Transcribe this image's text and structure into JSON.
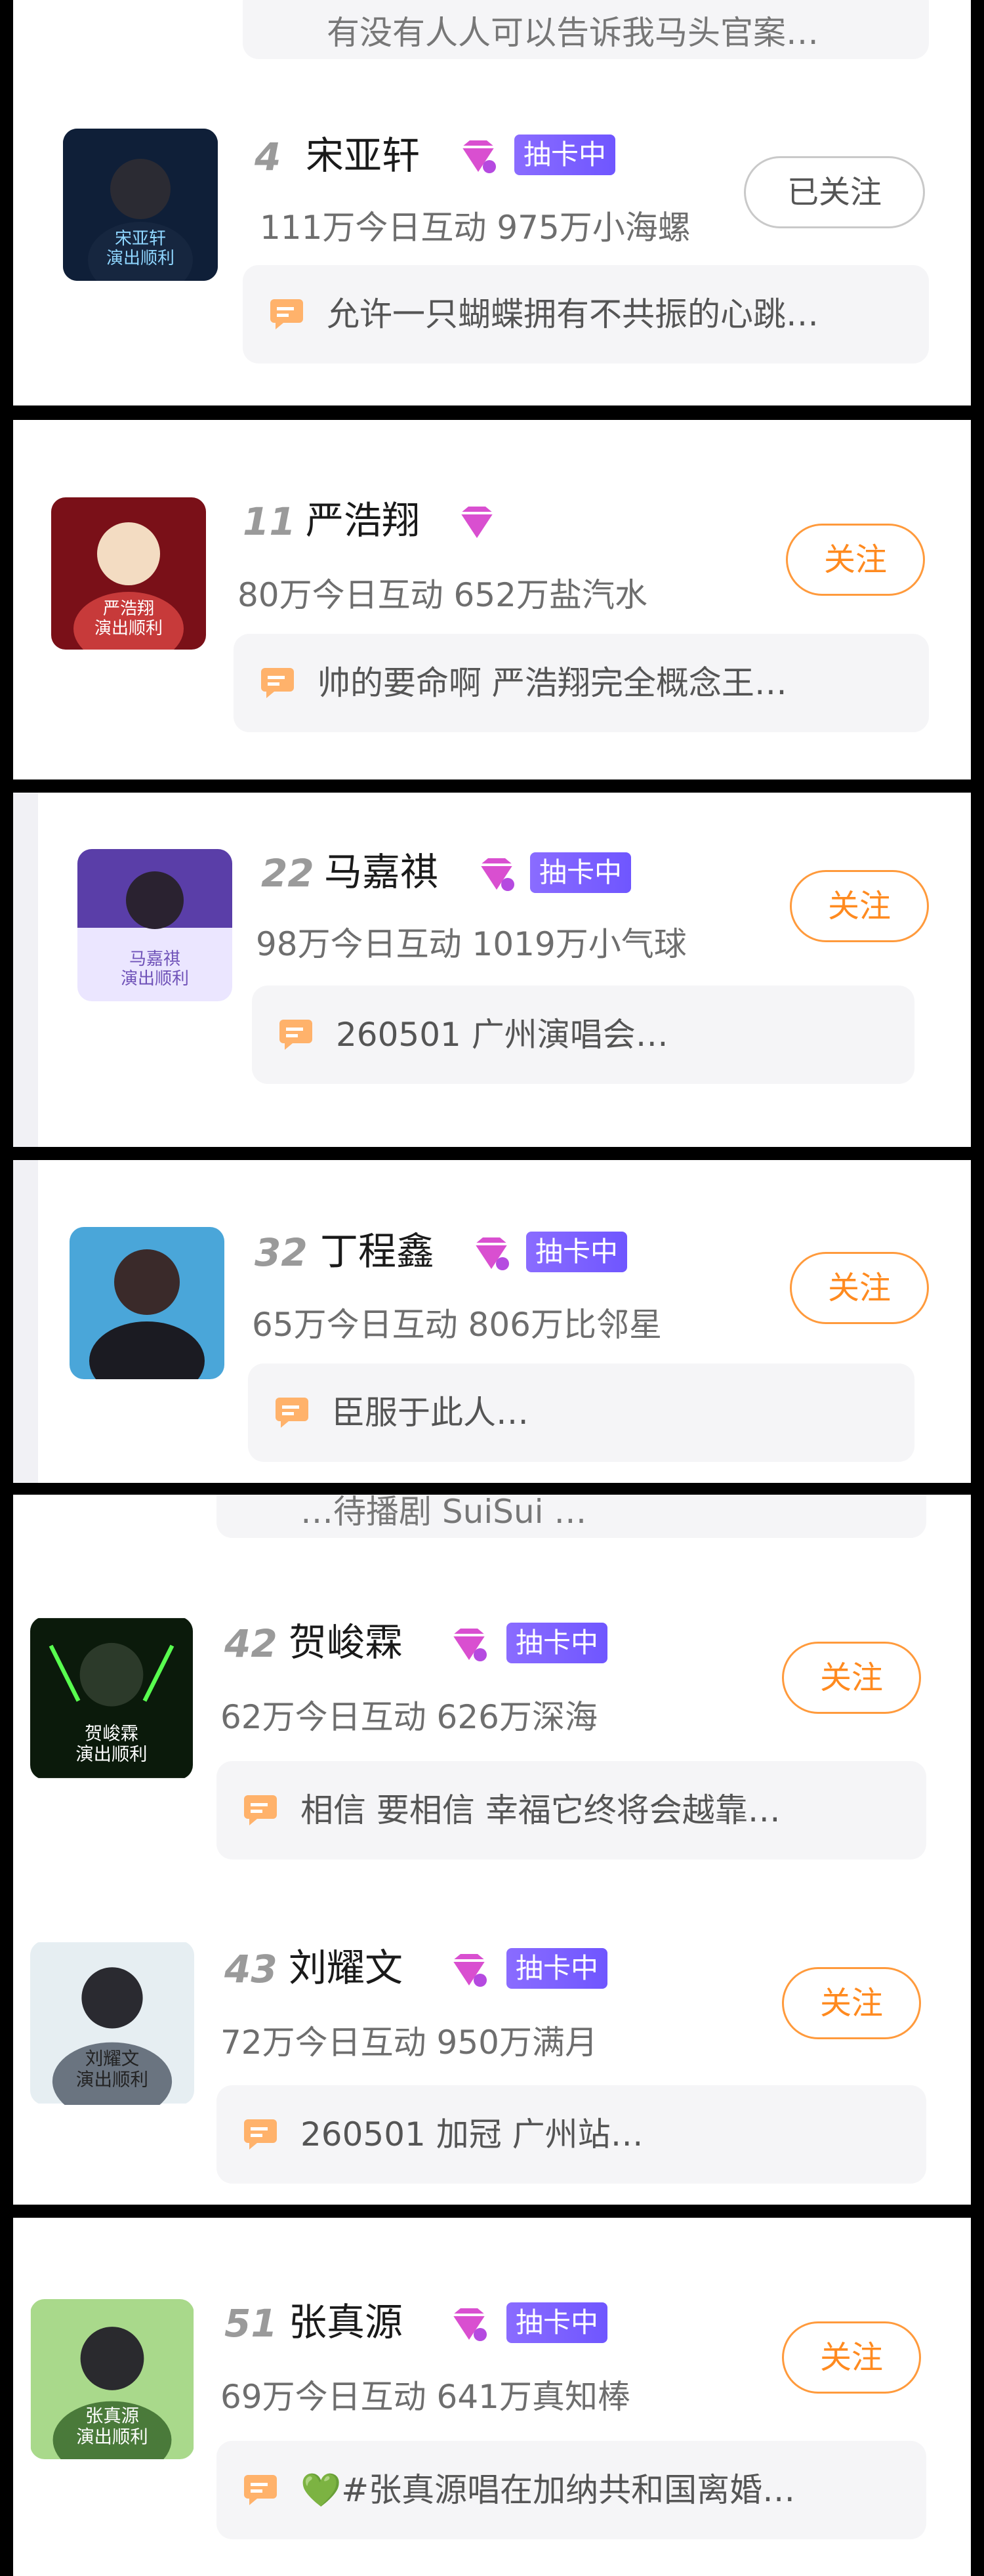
{
  "follow_label": "关注",
  "following_label": "已关注",
  "draw_badge": "抽卡中",
  "top_cut_comment": "有没有人人可以告诉我马头官案…",
  "mid_cut_comment": "…待播剧 SuiSui …",
  "entries": [
    {
      "rank": "4",
      "name": "宋亚轩",
      "badge": true,
      "stats": "111万今日互动 975万小海螺",
      "comment": "允许一只蝴蝶拥有不共振的心跳…",
      "followed": true,
      "avatar_text": "宋亚轩\n演出顺利"
    },
    {
      "rank": "11",
      "name": "严浩翔",
      "badge": false,
      "stats": "80万今日互动 652万盐汽水",
      "comment": "帅的要命啊 严浩翔完全概念王…",
      "followed": false,
      "avatar_text": "严浩翔\n演出顺利"
    },
    {
      "rank": "22",
      "name": "马嘉祺",
      "badge": true,
      "stats": "98万今日互动 1019万小气球",
      "comment": "260501  广州演唱会…",
      "followed": false,
      "avatar_text": "马嘉祺\n演出顺利"
    },
    {
      "rank": "32",
      "name": "丁程鑫",
      "badge": true,
      "stats": "65万今日互动 806万比邻星",
      "comment": "臣服于此人…",
      "followed": false,
      "avatar_text": ""
    },
    {
      "rank": "42",
      "name": "贺峻霖",
      "badge": true,
      "stats": "62万今日互动 626万深海",
      "comment": "相信 要相信 幸福它终将会越靠…",
      "followed": false,
      "avatar_text": "贺峻霖\n演出顺利"
    },
    {
      "rank": "43",
      "name": "刘耀文",
      "badge": true,
      "stats": "72万今日互动 950万满月",
      "comment": "260501 加冠 广州站…",
      "followed": false,
      "avatar_text": "刘耀文\n演出顺利"
    },
    {
      "rank": "51",
      "name": "张真源",
      "badge": true,
      "stats": "69万今日互动 641万真知棒",
      "comment": "💚#张真源唱在加纳共和国离婚…",
      "followed": false,
      "avatar_text": "张真源\n演出顺利"
    }
  ],
  "colors": {
    "accent_orange": "#ff8a1f",
    "badge_purple": "#7a5cff",
    "gem_pink": "#d94fd0"
  }
}
